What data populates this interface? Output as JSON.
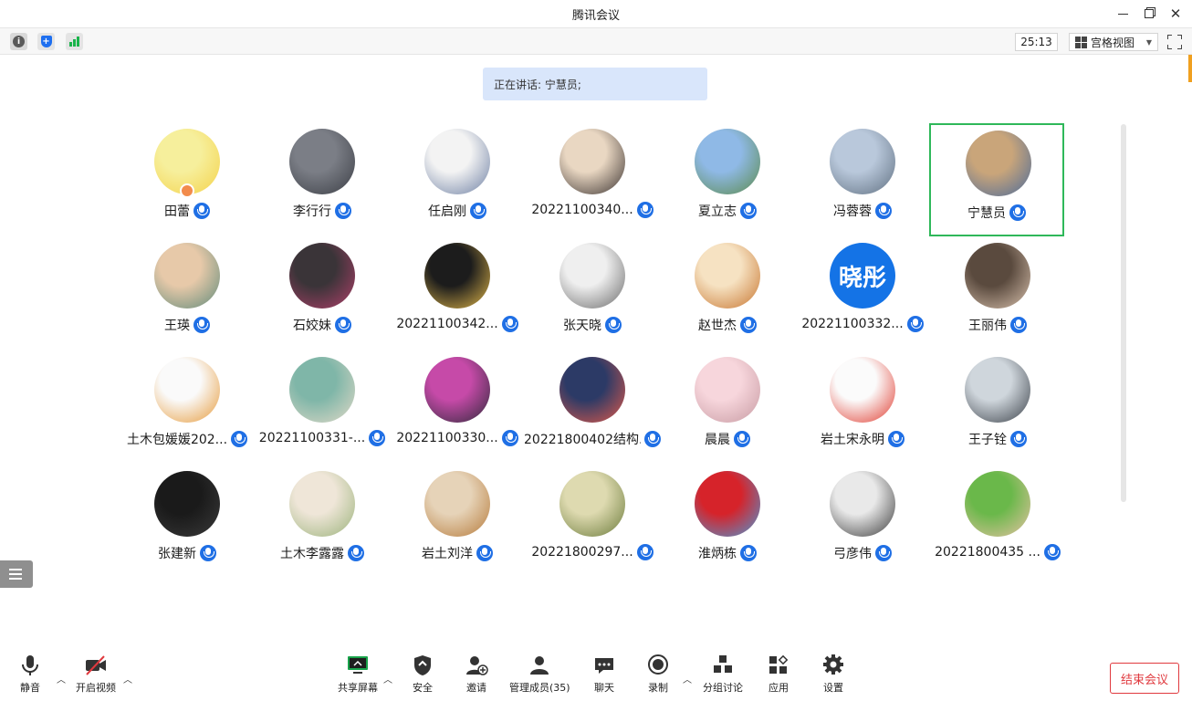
{
  "window": {
    "title": "腾讯会议"
  },
  "toolbar": {
    "timer": "25:13",
    "view_label": "宫格视图"
  },
  "speaking": {
    "text": "正在讲话: 宁慧员;"
  },
  "participants": [
    {
      "name": "田蕾",
      "avatar": [
        "#f6ef9c",
        "#f4d24a"
      ],
      "host": true
    },
    {
      "name": "李行行",
      "avatar": [
        "#7b7e86",
        "#3b3e45"
      ]
    },
    {
      "name": "任启刚",
      "avatar": [
        "#f3f3f3",
        "#6d7fa3"
      ]
    },
    {
      "name": "20221100340...",
      "avatar": [
        "#e9d7c2",
        "#3a3230"
      ]
    },
    {
      "name": "夏立志",
      "avatar": [
        "#8fb9e6",
        "#5b8a4a"
      ]
    },
    {
      "name": "冯蓉蓉",
      "avatar": [
        "#b9c8db",
        "#5f6f80"
      ]
    },
    {
      "name": "宁慧员",
      "avatar": [
        "#c9a57a",
        "#4a6a9a"
      ],
      "active": true
    },
    {
      "name": "王瑛",
      "avatar": [
        "#e7c9a9",
        "#5f8a7a"
      ]
    },
    {
      "name": "石姣妹",
      "avatar": [
        "#3a3438",
        "#b0406a"
      ]
    },
    {
      "name": "20221100342...",
      "avatar": [
        "#1c1c1c",
        "#e2b84a"
      ]
    },
    {
      "name": "张天晓",
      "avatar": [
        "#efefef",
        "#6a6a6a"
      ]
    },
    {
      "name": "赵世杰",
      "avatar": [
        "#f6e2c2",
        "#c7742e"
      ]
    },
    {
      "name": "20221100332...",
      "avatar_text": "晓彤"
    },
    {
      "name": "王丽伟",
      "avatar": [
        "#5a4a3e",
        "#d9c2ae"
      ]
    },
    {
      "name": "土木包媛媛202...",
      "avatar": [
        "#fafafa",
        "#e69a3a"
      ]
    },
    {
      "name": "20221100331-...",
      "avatar": [
        "#7fb6a8",
        "#e2d9c7"
      ]
    },
    {
      "name": "20221100330...",
      "avatar": [
        "#c64aa8",
        "#2e2a3a"
      ]
    },
    {
      "name": "20221800402结构...",
      "avatar": [
        "#2c3a66",
        "#e25a4a"
      ]
    },
    {
      "name": "晨晨",
      "avatar": [
        "#f7d6dc",
        "#c79aa2"
      ]
    },
    {
      "name": "岩土宋永明",
      "avatar": [
        "#fbfbfb",
        "#e03a2e"
      ]
    },
    {
      "name": "王子铨",
      "avatar": [
        "#cfd6dc",
        "#3a4048"
      ]
    },
    {
      "name": "张建新",
      "avatar": [
        "#1a1a1a",
        "#3a3a3a"
      ]
    },
    {
      "name": "土木李露露",
      "avatar": [
        "#efe6d8",
        "#9ab27a"
      ]
    },
    {
      "name": "岩土刘洋",
      "avatar": [
        "#e6d3b8",
        "#b67a3a"
      ]
    },
    {
      "name": "20221800297...",
      "avatar": [
        "#dedab0",
        "#6a7a3a"
      ]
    },
    {
      "name": "淮炳栋",
      "avatar": [
        "#d6232a",
        "#4a9ad6"
      ]
    },
    {
      "name": "弓彦伟",
      "avatar": [
        "#e9e9e9",
        "#3a3a3a"
      ]
    },
    {
      "name": "20221800435 ...",
      "avatar": [
        "#6ab84a",
        "#e7c2a4"
      ]
    }
  ],
  "bottom": {
    "mute": "静音",
    "video": "开启视频",
    "share": "共享屏幕",
    "security": "安全",
    "invite": "邀请",
    "members": "管理成员(35)",
    "chat": "聊天",
    "record": "录制",
    "breakout": "分组讨论",
    "apps": "应用",
    "settings": "设置",
    "end": "结束会议"
  }
}
